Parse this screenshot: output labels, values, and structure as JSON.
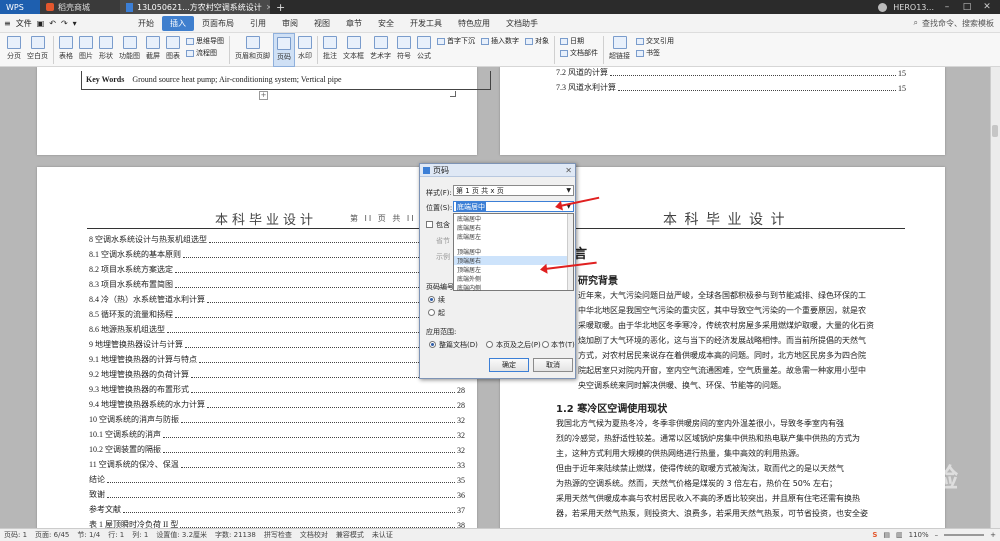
{
  "titlebar": {
    "tabs": [
      {
        "label": "WPS"
      },
      {
        "label": "稻壳商城"
      },
      {
        "label": "13L050621...方农村空调系统设计"
      }
    ],
    "new_tab": "+",
    "user": "HERO13..."
  },
  "menubar": {
    "file": "文件",
    "tabs": [
      "开始",
      "插入",
      "页面布局",
      "引用",
      "审阅",
      "视图",
      "章节",
      "安全",
      "开发工具",
      "特色应用",
      "文档助手"
    ],
    "active_tab": "插入",
    "search": "查找命令、搜索模板"
  },
  "ribbon": {
    "items": [
      "分页",
      "空白页",
      "表格",
      "图片",
      "形状",
      "功能图",
      "截屏",
      "图表",
      "文本框",
      "页眉和页脚",
      "页码",
      "水印",
      "批注",
      "艺术字",
      "符号",
      "公式"
    ],
    "small_items": [
      "思维导图",
      "流程图",
      "首字下沉",
      "插入数字",
      "对象",
      "日期",
      "文档部件",
      "超链接",
      "交叉引用",
      "书签",
      "页码"
    ],
    "selected": "页码"
  },
  "page_left_top": {
    "kw_label": "Key Words",
    "kw_text": "Ground source heat pump; Air-conditioning system; Vertical pipe"
  },
  "page_right_top": {
    "toc": [
      {
        "t": "7.3  风道水利计算",
        "p": "15"
      },
      {
        "t": "7.2  风道的计算",
        "p": "15"
      }
    ]
  },
  "page_left": {
    "header": "本科毕业设计",
    "header_page": "第 II 页 共 II 页",
    "toc": [
      {
        "t": "8  空调水系统设计与热泵机组选型",
        "p": "25"
      },
      {
        "t": "8.1  空调水系统的基本原则",
        "p": "25"
      },
      {
        "t": "8.2  项目水系统方案选定",
        "p": "25"
      },
      {
        "t": "8.3  项目水系统布置简图",
        "p": "25"
      },
      {
        "t": "8.4  冷（热）水系统管道水利计算",
        "p": "25"
      },
      {
        "t": "8.5  循环泵的流量和扬程",
        "p": "26"
      },
      {
        "t": "8.6  地源热泵机组选型",
        "p": "26"
      },
      {
        "t": "9  地埋管换热器设计与计算",
        "p": "27"
      },
      {
        "t": "9.1  地埋管换热器的计算与特点",
        "p": "27"
      },
      {
        "t": "9.2  地埋管换热器的负荷计算",
        "p": "27"
      },
      {
        "t": "9.3  地埋管换热器的布置形式",
        "p": "28"
      },
      {
        "t": "9.4  地埋管换热器系统的水力计算",
        "p": "28"
      },
      {
        "t": "10  空调系统的消声与防振",
        "p": "32"
      },
      {
        "t": "10.1  空调系统的消声",
        "p": "32"
      },
      {
        "t": "10.2  空调装置的隔振",
        "p": "32"
      },
      {
        "t": "11  空调系统的保冷、保温",
        "p": "33"
      },
      {
        "t": "结论",
        "p": "35"
      },
      {
        "t": "致谢",
        "p": "36"
      },
      {
        "t": "参考文献",
        "p": "37"
      },
      {
        "t": "表 1  屋顶瞬时冷负荷 II 型",
        "p": "38"
      }
    ]
  },
  "page_right": {
    "header": "本 科 毕 业 设 计",
    "chapter": "言",
    "sec1": "研究背景",
    "para1": [
      "近年来，大气污染问题日益严峻，全球各国都积极参与到节能减排、绿色环保的工",
      "中华北地区是我国空气污染的重灾区，其中导致空气污染的一个重要原因，就是农",
      "采暖取暖。由于华北地区冬季寒冷，传统农村房屋多采用燃煤炉取暖，大量的化石资",
      "烧加剧了大气环境的恶化，这与当下的经济发展战略相悖。而当前所提倡的天然气",
      "方式，对农村居民来说存在着供暖成本高的问题。同时，北方地区民房多为四合院",
      "院起居室只对院内开窗，室内空气流通困难，空气质量差。故急需一种家用小型中",
      "央空调系统来同时解决供暖、换气、环保、节能等的问题。"
    ],
    "sec2": "1.2  寒冷区空调使用现状",
    "para2": [
      "我国北方气候为夏热冬冷，冬季非供暖房间的室内外温差很小，导致冬季室内有强",
      "烈的冷感觉，热舒适性较差。通常以区域锅炉房集中供热和热电联产集中供热的方式为",
      "主，这种方式利用大规模的供热网络进行热量，集中高效的利用热源。",
      "但由于近年来陆续禁止燃煤，使得传统的取暖方式被淘汰，取而代之的是以天然气",
      "为热源的空调系统。然而，天然气价格是煤炭的 3 倍左右，热价在 50% 左右；",
      "采用天然气供暖成本高与农村居民收入不高的矛盾比较突出，并且原有住宅还需有换热",
      "器，若采用天然气热泵，则投资大、浪费多，若采用天然气热泵，可节省投资，也安全姿"
    ]
  },
  "dialog": {
    "title": "页码",
    "style_label": "样式(F):",
    "style_value": "第 1 页 共 x 页",
    "pos_label": "位置(S):",
    "pos_value": "底端居中",
    "options": [
      "底端居中",
      "底端居右",
      "底端居左",
      "顶端居中",
      "顶端居右",
      "顶端居左",
      "底端外侧",
      "底端内侧"
    ],
    "highlighted": "顶端居右",
    "include_label": "包含",
    "numbering_label": "页码编号",
    "r_cont": "续",
    "r_start": "起",
    "apply_label": "应用范围:",
    "apply_opts": [
      "整篇文档(D)",
      "本页及之后(P)",
      "本节(T)"
    ],
    "ok": "确定",
    "cancel": "取消",
    "partial": [
      "省节",
      "示例"
    ]
  },
  "statusbar": {
    "left": [
      "页码: 1",
      "页面: 6/45",
      "节: 1/4",
      "行: 1",
      "列: 1",
      "设置值: 3.2厘米",
      "字数: 21138",
      "拼写检查",
      "文档校对",
      "兼容模式",
      "未认证"
    ],
    "zoom": "110%",
    "brand": "S"
  },
  "watermark": "经验",
  "colors": {
    "accent": "#3f7fce",
    "arrow": "#e02020",
    "wps": "#1e5faf"
  }
}
